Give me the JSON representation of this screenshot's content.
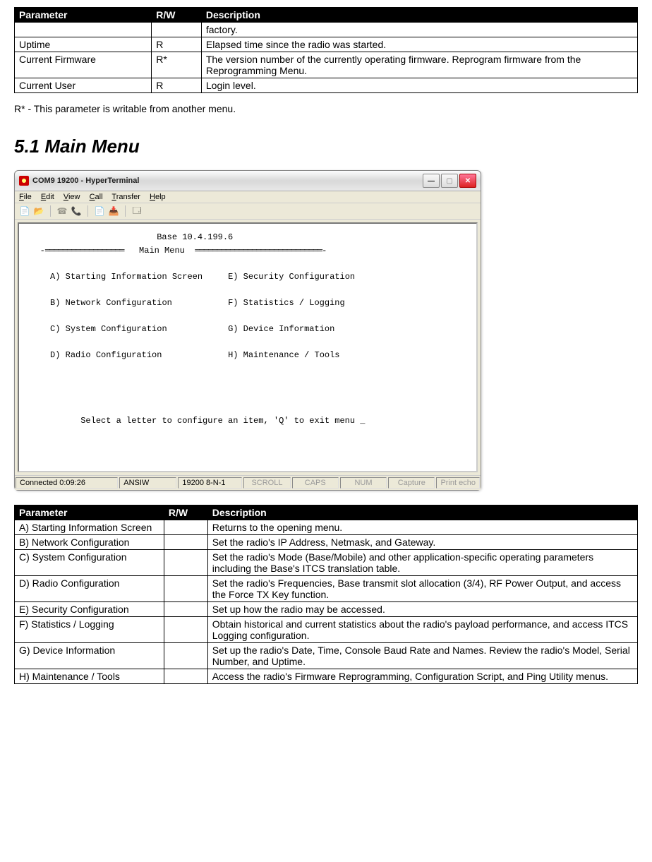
{
  "table1": {
    "headers": {
      "param": "Parameter",
      "rw": "R/W",
      "desc": "Description"
    },
    "rows": [
      {
        "param": "",
        "rw": "",
        "desc": "factory."
      },
      {
        "param": "Uptime",
        "rw": "R",
        "desc": "Elapsed time since the radio was started."
      },
      {
        "param": "Current Firmware",
        "rw": "R*",
        "desc": "The version number of the currently operating firmware. Reprogram firmware from the Reprogramming Menu."
      },
      {
        "param": "Current User",
        "rw": "R",
        "desc": "Login level."
      }
    ]
  },
  "note": "R* - This parameter is writable from another menu.",
  "section_heading": "5.1 Main Menu",
  "terminal": {
    "window_title": "COM9 19200 - HyperTerminal",
    "menubar": {
      "file": "File",
      "edit": "Edit",
      "view": "View",
      "call": "Call",
      "transfer": "Transfer",
      "help": "Help"
    },
    "header_line1": "Base 10.4.199.6",
    "header_line2": "Main Menu",
    "items": {
      "a": "A) Starting Information Screen",
      "b": "B) Network Configuration",
      "c": "C) System Configuration",
      "d": "D) Radio Configuration",
      "e": "E) Security Configuration",
      "f": "F) Statistics / Logging",
      "g": "G) Device Information",
      "h": "H) Maintenance / Tools"
    },
    "prompt": "Select a letter to configure an item, 'Q' to exit menu",
    "status": {
      "connected": "Connected 0:09:26",
      "encoding": "ANSIW",
      "settings": "19200 8-N-1",
      "scroll": "SCROLL",
      "caps": "CAPS",
      "num": "NUM",
      "capture": "Capture",
      "printecho": "Print echo"
    }
  },
  "table2": {
    "headers": {
      "param": "Parameter",
      "rw": "R/W",
      "desc": "Description"
    },
    "rows": [
      {
        "param": "A) Starting Information Screen",
        "rw": "",
        "desc": "Returns to the opening menu."
      },
      {
        "param": "B) Network Configuration",
        "rw": "",
        "desc": "Set the radio's IP Address, Netmask, and Gateway."
      },
      {
        "param": "C) System Configuration",
        "rw": "",
        "desc": "Set the radio's Mode (Base/Mobile) and other application-specific operating parameters including the Base's ITCS translation table."
      },
      {
        "param": "D) Radio Configuration",
        "rw": "",
        "desc": "Set the radio's Frequencies, Base transmit slot allocation (3/4), RF Power Output, and access the Force TX Key function."
      },
      {
        "param": "E) Security Configuration",
        "rw": "",
        "desc": "Set up how the radio may be accessed."
      },
      {
        "param": "F) Statistics / Logging",
        "rw": "",
        "desc": "Obtain historical and current statistics about the radio's payload performance, and access ITCS Logging configuration."
      },
      {
        "param": "G) Device Information",
        "rw": "",
        "desc": "Set up the radio's Date, Time, Console Baud Rate and Names. Review the radio's Model, Serial Number, and Uptime."
      },
      {
        "param": "H) Maintenance / Tools",
        "rw": "",
        "desc": "Access the radio's Firmware Reprogramming, Configuration Script, and Ping Utility menus."
      }
    ]
  }
}
